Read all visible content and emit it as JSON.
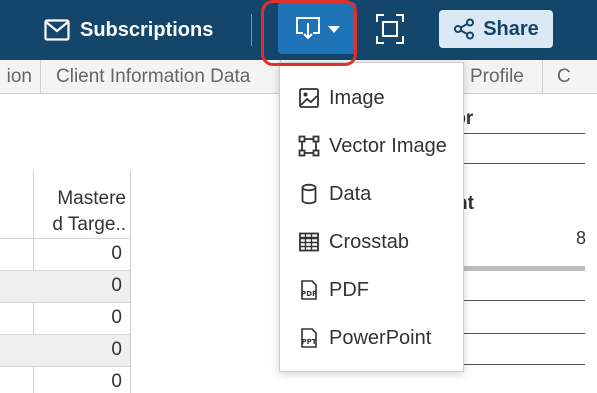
{
  "toolbar": {
    "subscriptions_label": "Subscriptions",
    "share_label": "Share"
  },
  "tabs": [
    {
      "label": "ion"
    },
    {
      "label": "Client Information Data"
    },
    {
      "label": "Profile"
    },
    {
      "label": "C"
    }
  ],
  "table": {
    "column_header_line1": "Mastere",
    "column_header_line2": "d Targe..",
    "rows": [
      {
        "value": "0"
      },
      {
        "value": "0"
      },
      {
        "value": "0"
      },
      {
        "value": "0"
      },
      {
        "value": "0"
      }
    ]
  },
  "right_panel": {
    "text1": "tor",
    "text2": "nt",
    "value": "8"
  },
  "download_menu": {
    "items": [
      {
        "label": "Image",
        "icon": "image-icon"
      },
      {
        "label": "Vector Image",
        "icon": "vector-image-icon"
      },
      {
        "label": "Data",
        "icon": "database-icon"
      },
      {
        "label": "Crosstab",
        "icon": "crosstab-icon"
      },
      {
        "label": "PDF",
        "icon": "pdf-icon",
        "tag": "PDF"
      },
      {
        "label": "PowerPoint",
        "icon": "powerpoint-icon",
        "tag": "PPT"
      }
    ]
  },
  "colors": {
    "toolbar_bg": "#14456b",
    "download_active": "#1f73b7",
    "highlight": "#e0302a",
    "share_bg": "#dbe9f6"
  }
}
